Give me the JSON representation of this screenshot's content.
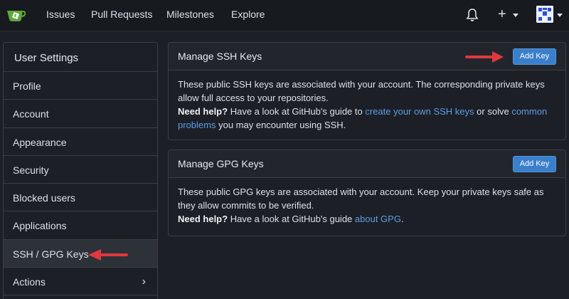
{
  "nav": {
    "issues": "Issues",
    "pull_requests": "Pull Requests",
    "milestones": "Milestones",
    "explore": "Explore",
    "plus": "+"
  },
  "sidebar": {
    "title": "User Settings",
    "items": [
      {
        "label": "Profile"
      },
      {
        "label": "Account"
      },
      {
        "label": "Appearance"
      },
      {
        "label": "Security"
      },
      {
        "label": "Blocked users"
      },
      {
        "label": "Applications"
      },
      {
        "label": "SSH / GPG Keys",
        "active": true
      },
      {
        "label": "Actions"
      }
    ],
    "chevron": "›"
  },
  "ssh": {
    "title": "Manage SSH Keys",
    "button": "Add Key",
    "desc": "These public SSH keys are associated with your account. The corresponding private keys allow full access to your repositories.",
    "help_label": "Need help?",
    "help_pre": "Have a look at GitHub's guide to",
    "link1": "create your own SSH keys",
    "help_mid": "or solve",
    "link2": "common problems",
    "help_post": "you may encounter using SSH."
  },
  "gpg": {
    "title": "Manage GPG Keys",
    "button": "Add Key",
    "desc": "These public GPG keys are associated with your account. Keep your private keys safe as they allow commits to be verified.",
    "help_label": "Need help?",
    "help_pre": "Have a look at GitHub's guide",
    "link1": "about GPG",
    "help_post": "."
  },
  "colors": {
    "accent": "#3a7fcb",
    "link": "#5a9fe6",
    "annotation": "#e0383e"
  }
}
